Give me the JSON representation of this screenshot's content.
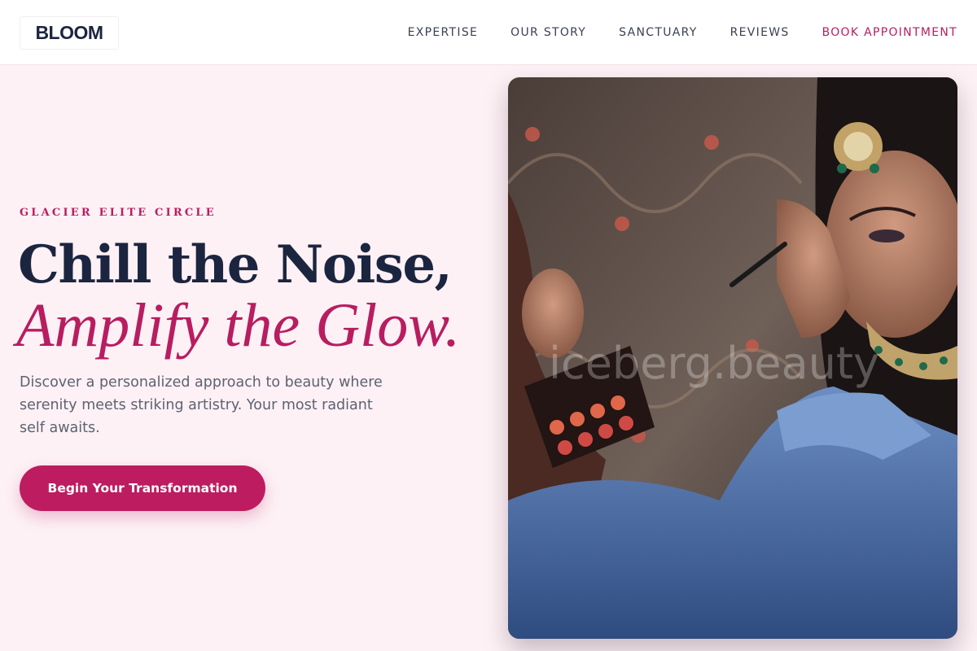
{
  "header": {
    "logo": "BLOOM",
    "nav": [
      {
        "label": "EXPERTISE"
      },
      {
        "label": "OUR STORY"
      },
      {
        "label": "SANCTUARY"
      },
      {
        "label": "REVIEWS"
      },
      {
        "label": "BOOK APPOINTMENT"
      }
    ]
  },
  "hero": {
    "eyebrow": "GLACIER ELITE CIRCLE",
    "headline_line1": "Chill the Noise,",
    "headline_line2": "Amplify the Glow.",
    "description": "Discover a personalized approach to beauty where serenity meets striking artistry. Your most radiant self awaits.",
    "cta_label": "Begin Your Transformation",
    "image_watermark": "iceberg.beauty"
  },
  "colors": {
    "accent": "#b81d60",
    "navy": "#1c2540",
    "background": "#fdf1f5"
  }
}
